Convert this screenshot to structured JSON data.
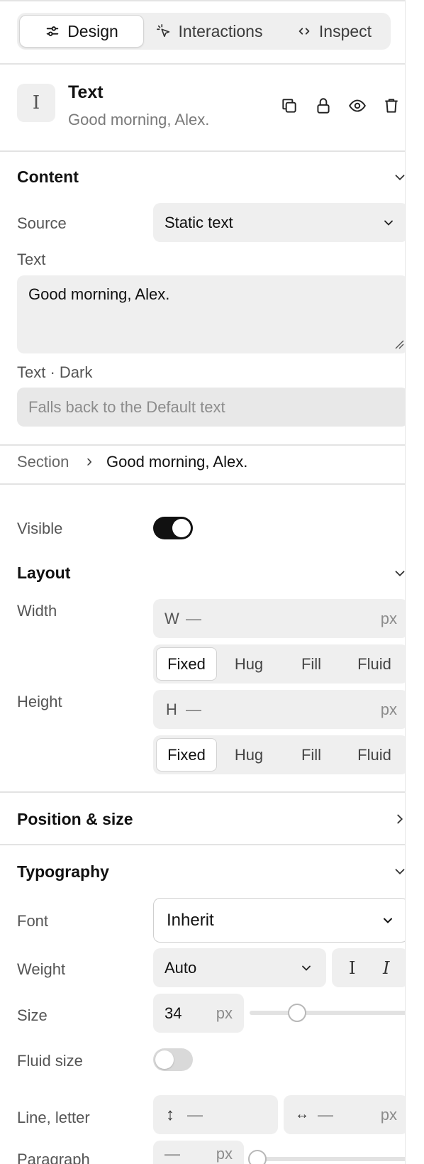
{
  "tabs": [
    {
      "label": "Design",
      "icon": "sliders-icon",
      "active": true
    },
    {
      "label": "Interactions",
      "icon": "cursor-click-icon",
      "active": false
    },
    {
      "label": "Inspect",
      "icon": "code-icon",
      "active": false
    }
  ],
  "element": {
    "icon_glyph": "I",
    "title": "Text",
    "subtitle": "Good morning, Alex.",
    "actions": [
      "duplicate-icon",
      "lock-icon",
      "eye-icon",
      "trash-icon"
    ]
  },
  "content": {
    "title": "Content",
    "source_label": "Source",
    "source_value": "Static text",
    "text_label": "Text",
    "text_value": "Good morning, Alex.",
    "dark_label": "Text · Dark",
    "dark_placeholder": "Falls back to the Default text"
  },
  "breadcrumb": {
    "parent": "Section",
    "separator": "›",
    "current": "Good morning, Alex."
  },
  "visible": {
    "label": "Visible",
    "on": true
  },
  "layout": {
    "title": "Layout",
    "width_label": "Width",
    "width_prefix": "W",
    "width_value": "—",
    "width_unit": "px",
    "width_modes": [
      "Fixed",
      "Hug",
      "Fill",
      "Fluid"
    ],
    "width_mode_selected": "Fixed",
    "height_label": "Height",
    "height_prefix": "H",
    "height_value": "—",
    "height_unit": "px",
    "height_modes": [
      "Fixed",
      "Hug",
      "Fill",
      "Fluid"
    ],
    "height_mode_selected": "Fixed"
  },
  "position_size": {
    "title": "Position & size"
  },
  "typography": {
    "title": "Typography",
    "font_label": "Font",
    "font_value": "Inherit",
    "weight_label": "Weight",
    "weight_value": "Auto",
    "size_label": "Size",
    "size_value": "34",
    "size_unit": "px",
    "size_slider_level": 0.3,
    "fluid_label": "Fluid size",
    "fluid_on": false,
    "line_letter_label": "Line, letter",
    "line_value": "—",
    "letter_value": "—",
    "letter_unit": "px",
    "paragraph_label": "Paragraph",
    "paragraph_value": "—",
    "paragraph_unit": "px"
  },
  "colors": {
    "toggle_on": "#111111",
    "toggle_off": "#d9d9d9"
  }
}
